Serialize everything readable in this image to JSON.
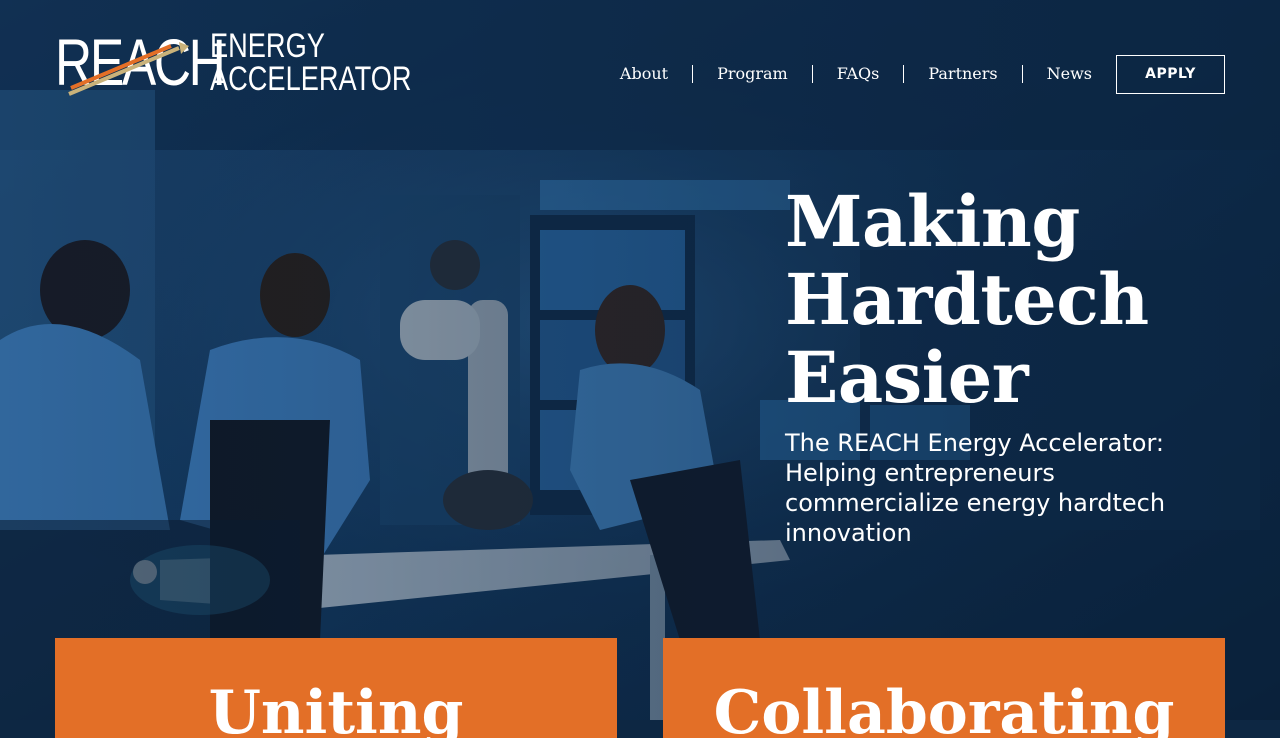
{
  "logo": {
    "primary": "REACH",
    "secondary_line1": "ENERGY",
    "secondary_line2": "ACCELERATOR"
  },
  "nav": {
    "items": [
      {
        "label": "About"
      },
      {
        "label": "Program"
      },
      {
        "label": "FAQs"
      },
      {
        "label": "Partners"
      },
      {
        "label": "News"
      }
    ],
    "apply_label": "APPLY"
  },
  "hero": {
    "title_line1": "Making",
    "title_line2": "Hardtech",
    "title_line3": "Easier",
    "subtitle": "The REACH Energy Accelerator: Helping entrepreneurs commercialize energy hardtech innovation"
  },
  "cards": [
    {
      "title": "Uniting"
    },
    {
      "title": "Collaborating"
    }
  ],
  "colors": {
    "accent_orange": "#e36f27",
    "logo_arrow": "#c9b27a",
    "hero_overlay": "#0d2743"
  }
}
